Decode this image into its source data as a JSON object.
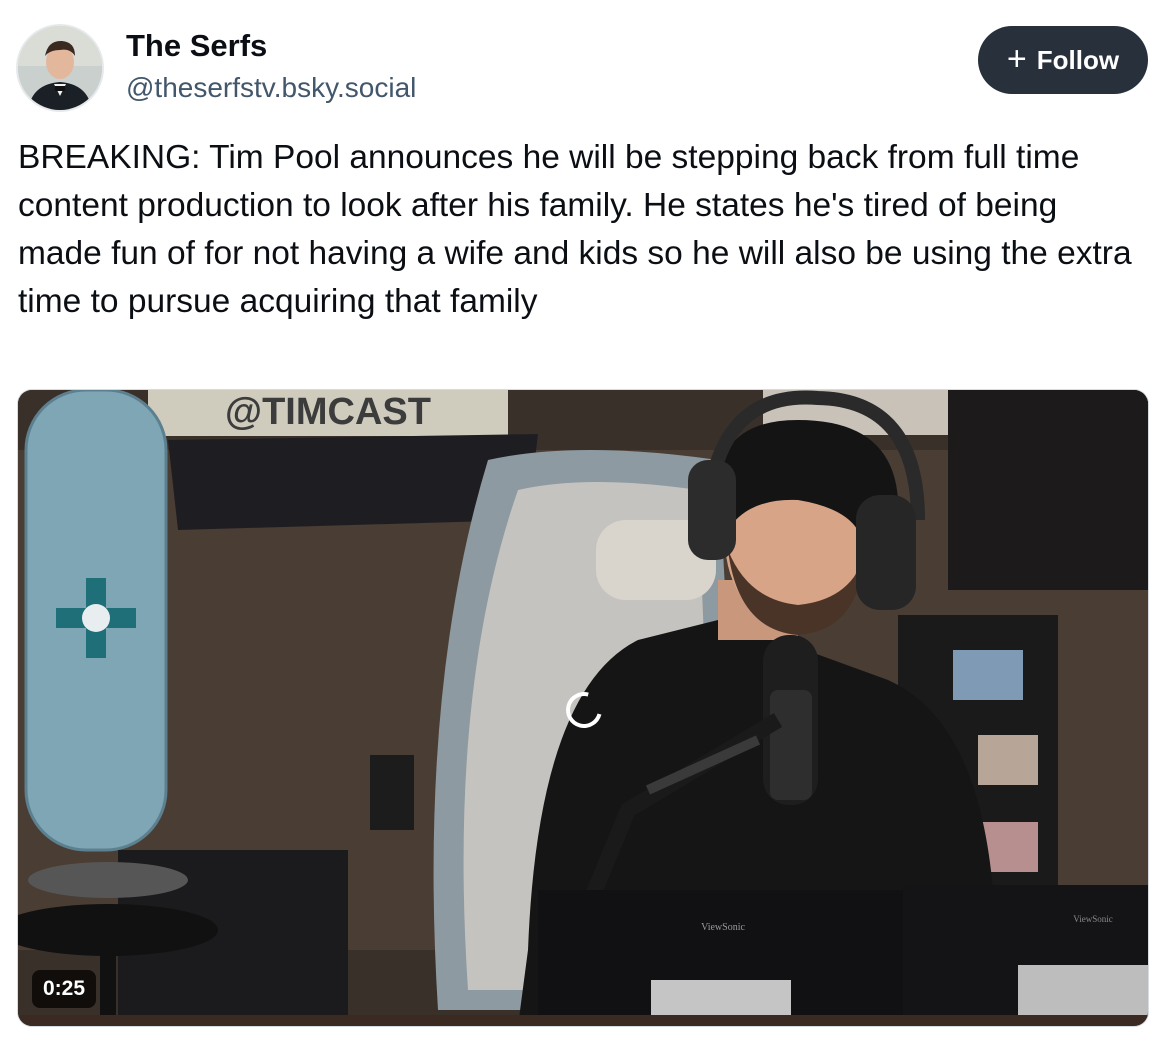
{
  "author": {
    "display_name": "The Serfs",
    "handle": "@theserfstv.bsky.social",
    "avatar_icon": "profile-photo-icon"
  },
  "follow_button": {
    "icon": "plus-icon",
    "label": "Follow"
  },
  "post": {
    "text": "BREAKING: Tim Pool announces he will be stepping back from full time content production to look after his family. He states he's tired of being made fun of for not having a wife and kids so he will also be using the extra time to pursue acquiring that family"
  },
  "video": {
    "duration": "0:25",
    "sign_text": "@TIMCAST",
    "monitor_brand_1": "ViewSonic",
    "monitor_brand_2": "ViewSonic",
    "state": "loading"
  },
  "colors": {
    "follow_bg": "#27303b",
    "handle": "#42576c",
    "text": "#0b0f14"
  }
}
